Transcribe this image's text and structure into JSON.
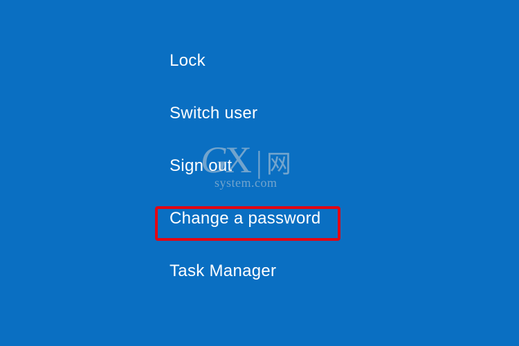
{
  "security_menu": {
    "items": [
      {
        "label": "Lock"
      },
      {
        "label": "Switch user"
      },
      {
        "label": "Sign out"
      },
      {
        "label": "Change a password"
      },
      {
        "label": "Task Manager"
      }
    ]
  },
  "watermark": {
    "g": "G",
    "x": "X",
    "divider": "|",
    "cn": "网",
    "sub": "system.com"
  }
}
